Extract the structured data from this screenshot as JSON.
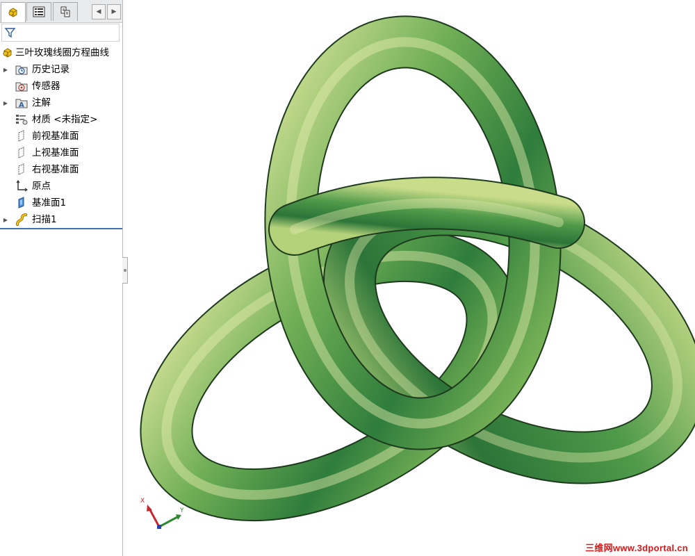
{
  "panel": {
    "tabs": [
      {
        "name": "featuremanager",
        "icon": "featuremanager-icon"
      },
      {
        "name": "propertymanager",
        "icon": "propertymanager-icon"
      },
      {
        "name": "configurationmanager",
        "icon": "configurationmanager-icon"
      }
    ],
    "nav_prev_icon": "left-arrow-icon",
    "nav_next_icon": "right-arrow-icon",
    "filter_icon": "filter-icon"
  },
  "tree": {
    "root": {
      "label": "三叶玫瑰线圈方程曲线",
      "icon": "part-icon"
    },
    "items": [
      {
        "label": "历史记录",
        "icon": "history-folder-icon",
        "expandable": true
      },
      {
        "label": "传感器",
        "icon": "sensor-folder-icon",
        "expandable": false
      },
      {
        "label": "注解",
        "icon": "annotations-icon",
        "expandable": true
      },
      {
        "label": "材质 <未指定>",
        "icon": "material-icon",
        "expandable": false
      },
      {
        "label": "前视基准面",
        "icon": "plane-icon",
        "expandable": false
      },
      {
        "label": "上视基准面",
        "icon": "plane-icon",
        "expandable": false
      },
      {
        "label": "右视基准面",
        "icon": "plane-icon",
        "expandable": false
      },
      {
        "label": "原点",
        "icon": "origin-icon",
        "expandable": false
      },
      {
        "label": "基准面1",
        "icon": "reference-plane-icon",
        "expandable": false
      },
      {
        "label": "扫描1",
        "icon": "sweep-icon",
        "expandable": true
      }
    ]
  },
  "viewport": {
    "model": "trefoil-knot-torus",
    "model_color": "#5f9e48",
    "triad": {
      "x_label": "X",
      "y_label": "Y",
      "x_color": "#c8272e",
      "y_color": "#2e8a2e",
      "z_color": "#2b3fb0"
    }
  },
  "watermark": "三维网www.3dportal.cn",
  "colors": {
    "accent": "#3d72b4",
    "watermark": "#d41a1a"
  }
}
